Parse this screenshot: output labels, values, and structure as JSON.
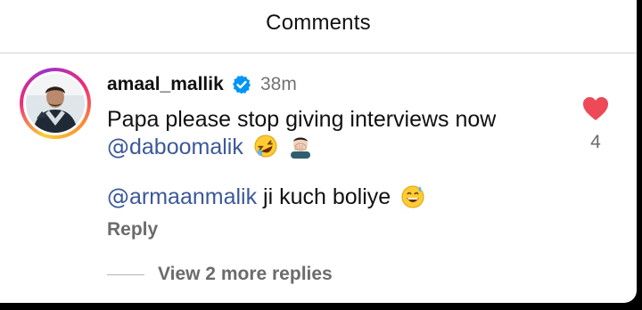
{
  "header": {
    "title": "Comments"
  },
  "comment": {
    "username": "amaal_mallik",
    "time": "38m",
    "text_line1": "Papa please stop giving interviews now",
    "mention1": "daboomalik",
    "mention2": "armaanmalik",
    "text_line3": " ji kuch boliye",
    "reply_label": "Reply",
    "likes": "4"
  },
  "replies": {
    "view_more_label": "View 2 more replies"
  },
  "icons": {
    "verified": "verified-badge-icon",
    "like": "heart-filled-icon",
    "laugh": "rolling-laughing-emoji",
    "facepalm": "facepalm-emoji",
    "sweat": "grinning-sweat-emoji"
  },
  "colors": {
    "heart": "#ed4956",
    "mention": "#3b5998",
    "verified": "#0095f6"
  }
}
